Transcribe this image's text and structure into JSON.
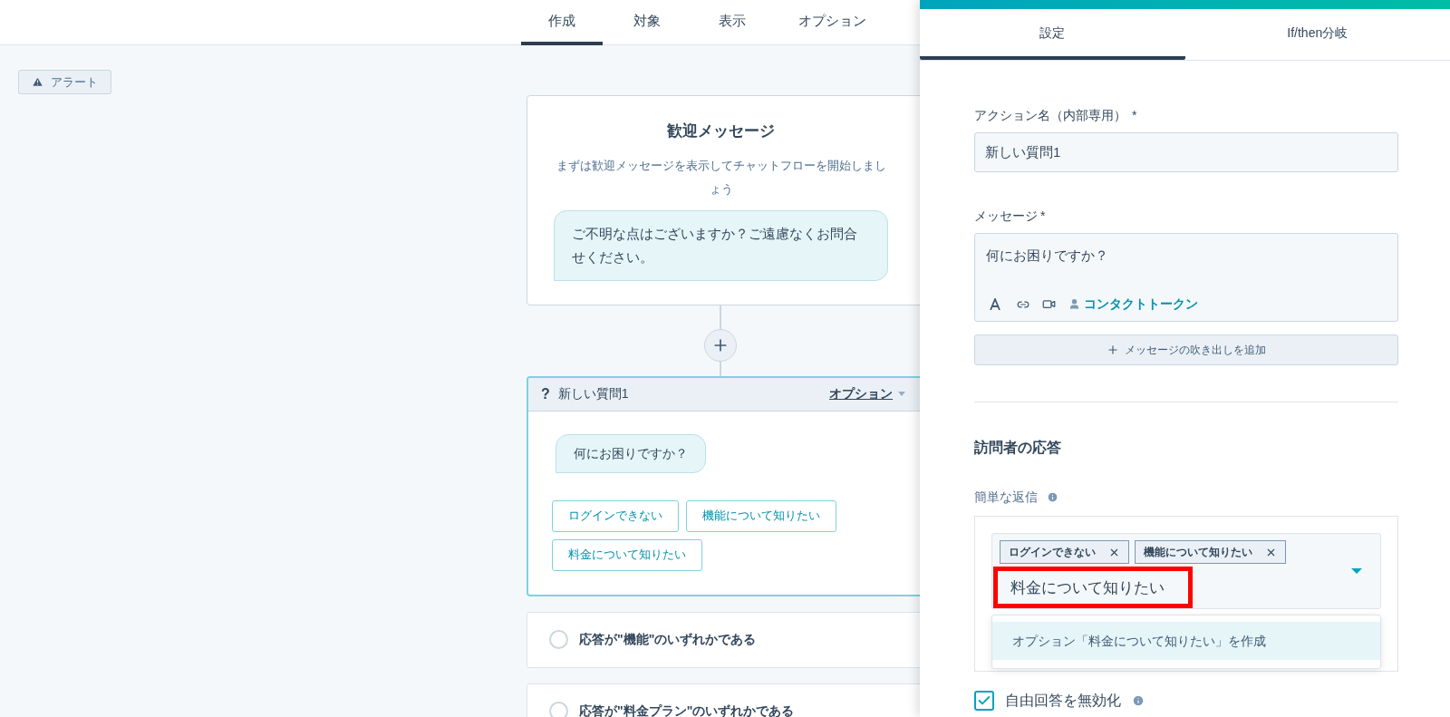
{
  "nav_tabs": [
    {
      "label": "作成",
      "selected": true
    },
    {
      "label": "対象",
      "selected": false
    },
    {
      "label": "表示",
      "selected": false
    },
    {
      "label": "オプション",
      "selected": false
    }
  ],
  "alert_button": "アラート",
  "welcome_card": {
    "title": "歓迎メッセージ",
    "description": "まずは歓迎メッセージを表示してチャットフローを開始しましょう",
    "bubble": "ご不明な点はございますか？ご遠慮なくお問合せください。"
  },
  "question_card": {
    "icon": "?",
    "title": "新しい質問1",
    "options_link": "オプション",
    "bubble": "何にお困りですか？",
    "quick_replies": [
      "ログインできない",
      "機能について知りたい",
      "料金について知りたい"
    ]
  },
  "branches": [
    "応答が\"機能\"のいずれかである",
    "応答が\"料金プラン\"のいずれかである"
  ],
  "panel": {
    "tabs": [
      {
        "label": "設定",
        "selected": true
      },
      {
        "label": "If/then分岐",
        "selected": false
      }
    ],
    "action_name": {
      "label": "アクション名（内部専用）",
      "required_mark": "*",
      "value": "新しい質問1"
    },
    "message": {
      "label": "メッセージ",
      "required_mark": "*",
      "value": "何にお困りですか？",
      "token_link": "コンタクトトークン"
    },
    "add_bubble_button": "メッセージの吹き出しを追加",
    "section_title": "訪問者の応答",
    "quick_replies": {
      "label": "簡単な返信",
      "tags": [
        "ログインできない",
        "機能について知りたい"
      ],
      "input_value": "料金について知りたい",
      "highlighted": true,
      "suggestion": "オプション「料金について知りたい」を作成"
    },
    "disable_free_text": {
      "label": "自由回答を無効化",
      "checked": true
    }
  }
}
